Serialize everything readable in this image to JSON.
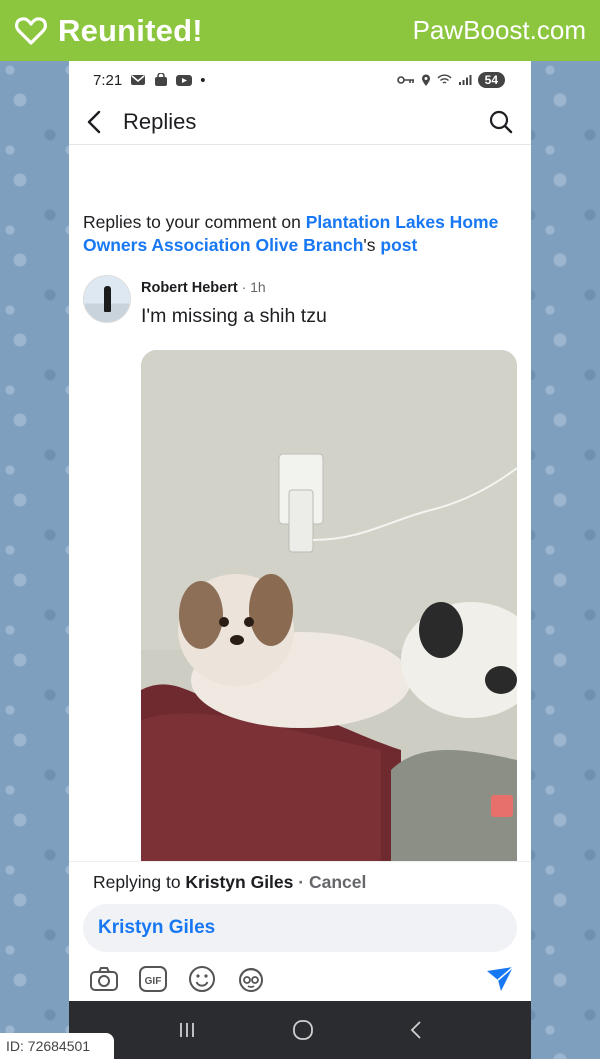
{
  "banner": {
    "reunited_label": "Reunited!",
    "site_label": "PawBoost.com",
    "bg_color": "#8cc63f"
  },
  "statusbar": {
    "time": "7:21",
    "dot": "•",
    "battery": "54"
  },
  "nav": {
    "title": "Replies"
  },
  "context": {
    "prefix": "Replies to your comment on ",
    "group_link": "Plantation Lakes Home Owners Association Olive Branch",
    "possessive": "'s ",
    "post_link": "post"
  },
  "comment": {
    "author": "Robert Hebert",
    "separator": " · ",
    "time": "1h",
    "text": "I'm missing a shih tzu"
  },
  "reply": {
    "replying_prefix": "Replying to ",
    "replying_to": "Kristyn Giles",
    "separator": " · ",
    "cancel": "Cancel",
    "input_value": "Kristyn Giles",
    "gif_label": "GIF"
  },
  "system_nav": {
    "recents_glyph": "III",
    "home_glyph": "○",
    "back_glyph": "‹"
  },
  "id_tag": {
    "label": "ID: 72684501"
  },
  "colors": {
    "link": "#1877f2",
    "send": "#1877f2"
  }
}
